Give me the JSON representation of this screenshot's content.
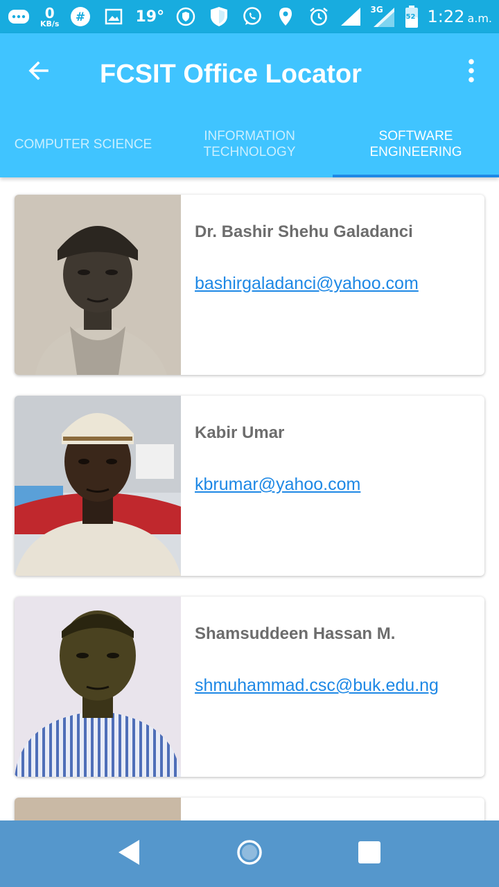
{
  "status_bar": {
    "speed_value": "0",
    "speed_unit": "KB/s",
    "temperature": "19°",
    "network": "3G",
    "battery": "52",
    "time": "1:22",
    "ampm": "a.m."
  },
  "toolbar": {
    "title": "FCSIT Office Locator",
    "back_icon": "arrow-back-icon",
    "menu_icon": "more-vert-icon"
  },
  "tabs": [
    {
      "label": "COMPUTER SCIENCE",
      "active": false
    },
    {
      "label": "INFORMATION TECHNOLOGY",
      "active": false
    },
    {
      "label": "SOFTWARE ENGINEERING",
      "active": true
    }
  ],
  "staff": [
    {
      "name": "Dr. Bashir Shehu Galadanci",
      "email": "bashirgaladanci@yahoo.com"
    },
    {
      "name": "Kabir Umar",
      "email": "kbrumar@yahoo.com"
    },
    {
      "name": "Shamsuddeen Hassan M.",
      "email": "shmuhammad.csc@buk.edu.ng"
    }
  ],
  "colors": {
    "status_bar": "#18acdf",
    "app_bar": "#40c4ff",
    "tab_indicator": "#1e88e5",
    "link": "#1e88e5",
    "nav_bar": "#5597cc"
  }
}
